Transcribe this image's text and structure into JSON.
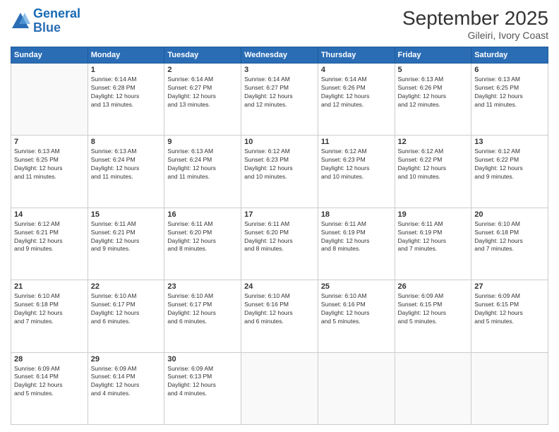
{
  "logo": {
    "line1": "General",
    "line2": "Blue"
  },
  "title": "September 2025",
  "subtitle": "Gileiri, Ivory Coast",
  "weekdays": [
    "Sunday",
    "Monday",
    "Tuesday",
    "Wednesday",
    "Thursday",
    "Friday",
    "Saturday"
  ],
  "weeks": [
    [
      {
        "day": "",
        "sunrise": "",
        "sunset": "",
        "daylight": ""
      },
      {
        "day": "1",
        "sunrise": "Sunrise: 6:14 AM",
        "sunset": "Sunset: 6:28 PM",
        "daylight": "Daylight: 12 hours and 13 minutes."
      },
      {
        "day": "2",
        "sunrise": "Sunrise: 6:14 AM",
        "sunset": "Sunset: 6:27 PM",
        "daylight": "Daylight: 12 hours and 13 minutes."
      },
      {
        "day": "3",
        "sunrise": "Sunrise: 6:14 AM",
        "sunset": "Sunset: 6:27 PM",
        "daylight": "Daylight: 12 hours and 12 minutes."
      },
      {
        "day": "4",
        "sunrise": "Sunrise: 6:14 AM",
        "sunset": "Sunset: 6:26 PM",
        "daylight": "Daylight: 12 hours and 12 minutes."
      },
      {
        "day": "5",
        "sunrise": "Sunrise: 6:13 AM",
        "sunset": "Sunset: 6:26 PM",
        "daylight": "Daylight: 12 hours and 12 minutes."
      },
      {
        "day": "6",
        "sunrise": "Sunrise: 6:13 AM",
        "sunset": "Sunset: 6:25 PM",
        "daylight": "Daylight: 12 hours and 11 minutes."
      }
    ],
    [
      {
        "day": "7",
        "sunrise": "Sunrise: 6:13 AM",
        "sunset": "Sunset: 6:25 PM",
        "daylight": "Daylight: 12 hours and 11 minutes."
      },
      {
        "day": "8",
        "sunrise": "Sunrise: 6:13 AM",
        "sunset": "Sunset: 6:24 PM",
        "daylight": "Daylight: 12 hours and 11 minutes."
      },
      {
        "day": "9",
        "sunrise": "Sunrise: 6:13 AM",
        "sunset": "Sunset: 6:24 PM",
        "daylight": "Daylight: 12 hours and 11 minutes."
      },
      {
        "day": "10",
        "sunrise": "Sunrise: 6:12 AM",
        "sunset": "Sunset: 6:23 PM",
        "daylight": "Daylight: 12 hours and 10 minutes."
      },
      {
        "day": "11",
        "sunrise": "Sunrise: 6:12 AM",
        "sunset": "Sunset: 6:23 PM",
        "daylight": "Daylight: 12 hours and 10 minutes."
      },
      {
        "day": "12",
        "sunrise": "Sunrise: 6:12 AM",
        "sunset": "Sunset: 6:22 PM",
        "daylight": "Daylight: 12 hours and 10 minutes."
      },
      {
        "day": "13",
        "sunrise": "Sunrise: 6:12 AM",
        "sunset": "Sunset: 6:22 PM",
        "daylight": "Daylight: 12 hours and 9 minutes."
      }
    ],
    [
      {
        "day": "14",
        "sunrise": "Sunrise: 6:12 AM",
        "sunset": "Sunset: 6:21 PM",
        "daylight": "Daylight: 12 hours and 9 minutes."
      },
      {
        "day": "15",
        "sunrise": "Sunrise: 6:11 AM",
        "sunset": "Sunset: 6:21 PM",
        "daylight": "Daylight: 12 hours and 9 minutes."
      },
      {
        "day": "16",
        "sunrise": "Sunrise: 6:11 AM",
        "sunset": "Sunset: 6:20 PM",
        "daylight": "Daylight: 12 hours and 8 minutes."
      },
      {
        "day": "17",
        "sunrise": "Sunrise: 6:11 AM",
        "sunset": "Sunset: 6:20 PM",
        "daylight": "Daylight: 12 hours and 8 minutes."
      },
      {
        "day": "18",
        "sunrise": "Sunrise: 6:11 AM",
        "sunset": "Sunset: 6:19 PM",
        "daylight": "Daylight: 12 hours and 8 minutes."
      },
      {
        "day": "19",
        "sunrise": "Sunrise: 6:11 AM",
        "sunset": "Sunset: 6:19 PM",
        "daylight": "Daylight: 12 hours and 7 minutes."
      },
      {
        "day": "20",
        "sunrise": "Sunrise: 6:10 AM",
        "sunset": "Sunset: 6:18 PM",
        "daylight": "Daylight: 12 hours and 7 minutes."
      }
    ],
    [
      {
        "day": "21",
        "sunrise": "Sunrise: 6:10 AM",
        "sunset": "Sunset: 6:18 PM",
        "daylight": "Daylight: 12 hours and 7 minutes."
      },
      {
        "day": "22",
        "sunrise": "Sunrise: 6:10 AM",
        "sunset": "Sunset: 6:17 PM",
        "daylight": "Daylight: 12 hours and 6 minutes."
      },
      {
        "day": "23",
        "sunrise": "Sunrise: 6:10 AM",
        "sunset": "Sunset: 6:17 PM",
        "daylight": "Daylight: 12 hours and 6 minutes."
      },
      {
        "day": "24",
        "sunrise": "Sunrise: 6:10 AM",
        "sunset": "Sunset: 6:16 PM",
        "daylight": "Daylight: 12 hours and 6 minutes."
      },
      {
        "day": "25",
        "sunrise": "Sunrise: 6:10 AM",
        "sunset": "Sunset: 6:16 PM",
        "daylight": "Daylight: 12 hours and 5 minutes."
      },
      {
        "day": "26",
        "sunrise": "Sunrise: 6:09 AM",
        "sunset": "Sunset: 6:15 PM",
        "daylight": "Daylight: 12 hours and 5 minutes."
      },
      {
        "day": "27",
        "sunrise": "Sunrise: 6:09 AM",
        "sunset": "Sunset: 6:15 PM",
        "daylight": "Daylight: 12 hours and 5 minutes."
      }
    ],
    [
      {
        "day": "28",
        "sunrise": "Sunrise: 6:09 AM",
        "sunset": "Sunset: 6:14 PM",
        "daylight": "Daylight: 12 hours and 5 minutes."
      },
      {
        "day": "29",
        "sunrise": "Sunrise: 6:09 AM",
        "sunset": "Sunset: 6:14 PM",
        "daylight": "Daylight: 12 hours and 4 minutes."
      },
      {
        "day": "30",
        "sunrise": "Sunrise: 6:09 AM",
        "sunset": "Sunset: 6:13 PM",
        "daylight": "Daylight: 12 hours and 4 minutes."
      },
      {
        "day": "",
        "sunrise": "",
        "sunset": "",
        "daylight": ""
      },
      {
        "day": "",
        "sunrise": "",
        "sunset": "",
        "daylight": ""
      },
      {
        "day": "",
        "sunrise": "",
        "sunset": "",
        "daylight": ""
      },
      {
        "day": "",
        "sunrise": "",
        "sunset": "",
        "daylight": ""
      }
    ]
  ]
}
